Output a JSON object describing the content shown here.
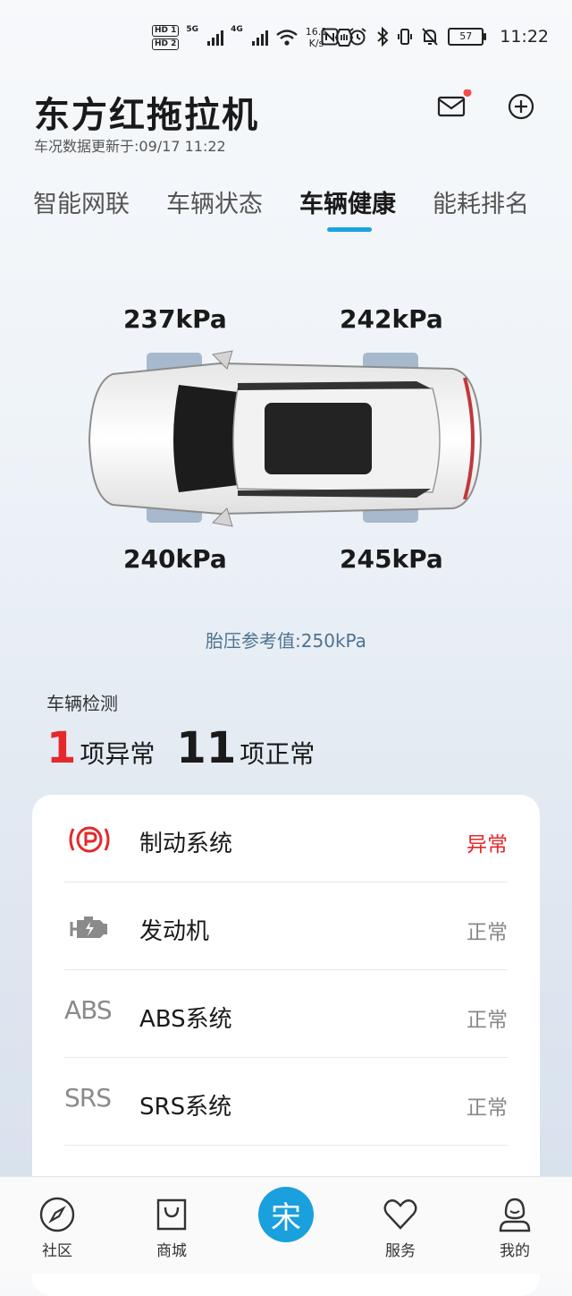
{
  "status_bar": {
    "hd1": "HD 1",
    "hd2": "HD 2",
    "net1": "5G",
    "net2": "4G",
    "speed_value": "16.1",
    "speed_unit": "K/s",
    "battery": "57",
    "time": "11:22"
  },
  "header": {
    "title": "东方红拖拉机",
    "update_text": "车况数据更新于:09/17 11:22"
  },
  "tabs": [
    {
      "label": "智能网联"
    },
    {
      "label": "车辆状态"
    },
    {
      "label": "车辆健康"
    },
    {
      "label": "能耗排名"
    }
  ],
  "active_tab": "车辆健康",
  "tires": {
    "front_left": "237kPa",
    "front_right": "242kPa",
    "rear_left": "240kPa",
    "rear_right": "245kPa",
    "reference": "胎压参考值:250kPa"
  },
  "detection": {
    "label": "车辆检测",
    "abnormal_count": "1",
    "abnormal_unit": "项异常",
    "normal_count": "11",
    "normal_unit": "项正常"
  },
  "systems": [
    {
      "name": "制动系统",
      "status": "异常",
      "icon": "parking-brake-icon"
    },
    {
      "name": "发动机",
      "status": "正常",
      "icon": "engine-icon"
    },
    {
      "name": "ABS系统",
      "status": "正常",
      "icon": "ABS"
    },
    {
      "name": "SRS系统",
      "status": "正常",
      "icon": "SRS"
    }
  ],
  "nav": [
    {
      "label": "社区",
      "icon": "compass-icon"
    },
    {
      "label": "商城",
      "icon": "shopping-bag-icon"
    },
    {
      "label": "服务",
      "icon": "heart-icon"
    },
    {
      "label": "我的",
      "icon": "profile-icon"
    }
  ],
  "center_button": {
    "glyph": "宋"
  },
  "colors": {
    "accent": "#1aa3e0",
    "alert": "#e4292c",
    "reference_text": "#4f7390"
  }
}
